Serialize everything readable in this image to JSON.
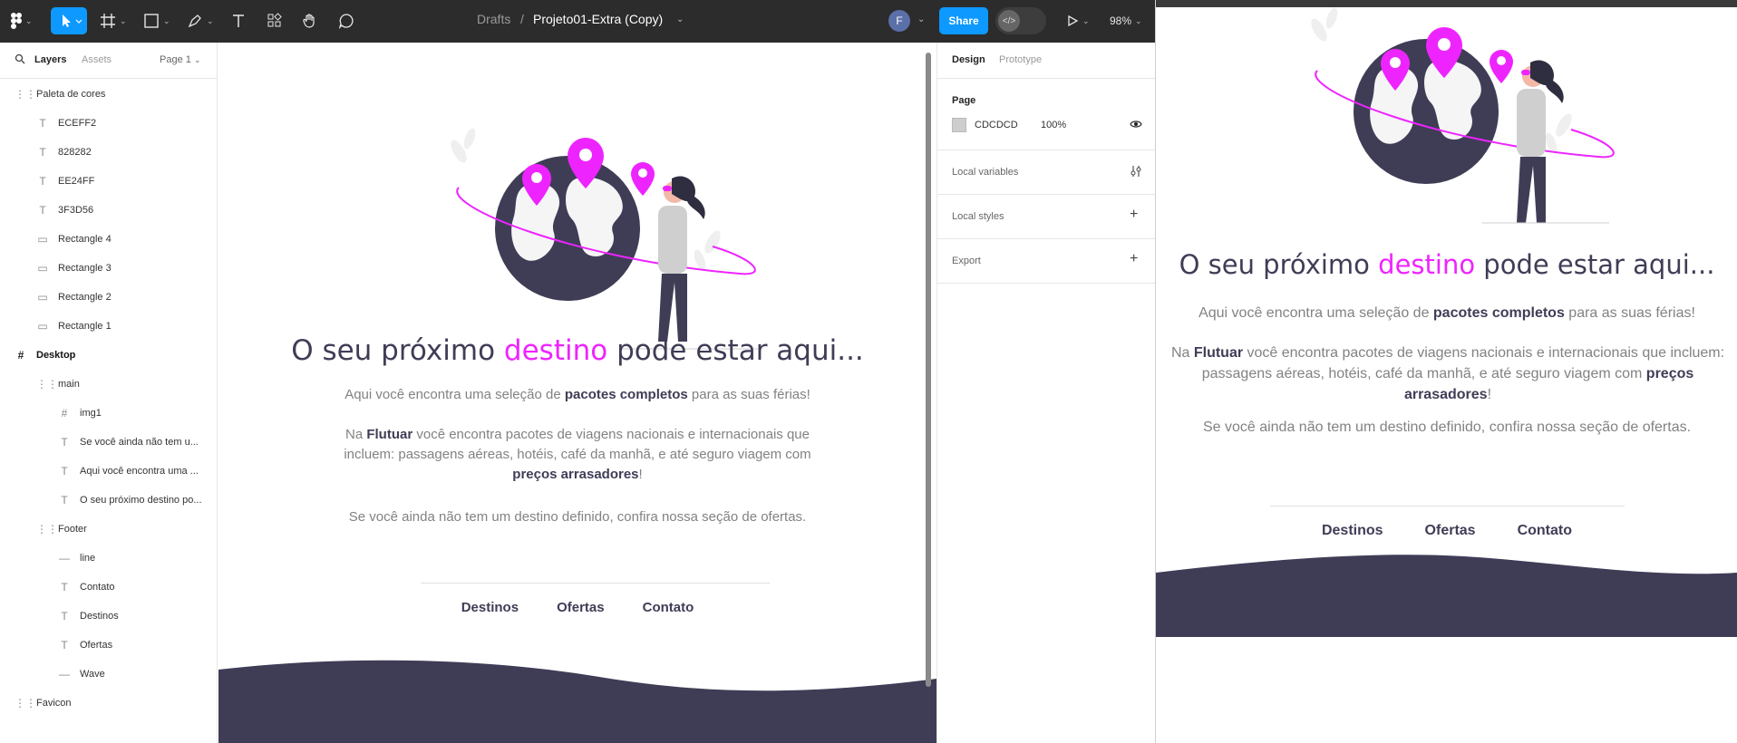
{
  "toolbar": {
    "breadcrumb_root": "Drafts",
    "breadcrumb_sep": "/",
    "file_name": "Projeto01-Extra (Copy)",
    "avatar_initial": "F",
    "share_label": "Share",
    "zoom": "98%"
  },
  "left_panel": {
    "tab_layers": "Layers",
    "tab_assets": "Assets",
    "page_selector": "Page 1",
    "layers": [
      {
        "label": "Paleta de cores",
        "icon": "section-icon",
        "depth": 0
      },
      {
        "label": "ECEFF2",
        "icon": "text-icon",
        "depth": 1
      },
      {
        "label": "828282",
        "icon": "text-icon",
        "depth": 1
      },
      {
        "label": "EE24FF",
        "icon": "text-icon",
        "depth": 1
      },
      {
        "label": "3F3D56",
        "icon": "text-icon",
        "depth": 1
      },
      {
        "label": "Rectangle 4",
        "icon": "rectangle-icon",
        "depth": 1
      },
      {
        "label": "Rectangle 3",
        "icon": "rectangle-icon",
        "depth": 1
      },
      {
        "label": "Rectangle 2",
        "icon": "rectangle-icon",
        "depth": 1
      },
      {
        "label": "Rectangle 1",
        "icon": "rectangle-icon",
        "depth": 1
      },
      {
        "label": "Desktop",
        "icon": "frame-icon",
        "depth": 0
      },
      {
        "label": "main",
        "icon": "group-icon",
        "depth": 1
      },
      {
        "label": "img1",
        "icon": "frame-icon",
        "depth": 2
      },
      {
        "label": "Se você ainda não tem u...",
        "icon": "text-icon",
        "depth": 2
      },
      {
        "label": "Aqui você encontra uma ...",
        "icon": "text-icon",
        "depth": 2
      },
      {
        "label": "O seu próximo destino po...",
        "icon": "text-icon",
        "depth": 2
      },
      {
        "label": "Footer",
        "icon": "group-icon",
        "depth": 1
      },
      {
        "label": "line",
        "icon": "line-icon",
        "depth": 2
      },
      {
        "label": "Contato",
        "icon": "text-icon",
        "depth": 2
      },
      {
        "label": "Destinos",
        "icon": "text-icon",
        "depth": 2
      },
      {
        "label": "Ofertas",
        "icon": "text-icon",
        "depth": 2
      },
      {
        "label": "Wave",
        "icon": "line-icon",
        "depth": 2
      },
      {
        "label": "Favicon",
        "icon": "section-icon",
        "depth": 0
      }
    ]
  },
  "right_panel": {
    "tab_design": "Design",
    "tab_prototype": "Prototype",
    "page_label": "Page",
    "page_color": "CDCDCD",
    "page_opacity": "100%",
    "local_variables": "Local variables",
    "local_styles": "Local styles",
    "export": "Export"
  },
  "site": {
    "heading_pre": "O seu próximo ",
    "heading_highlight": "destino",
    "heading_post": " pode estar aqui...",
    "p1_pre": "Aqui você encontra uma seleção de ",
    "p1_bold": "pacotes completos",
    "p1_post": " para as suas férias!",
    "p2_pre": "Na ",
    "p2_bold1": "Flutuar",
    "p2_mid": " você encontra pacotes de viagens nacionais e internacionais que incluem: passagens aéreas, hotéis, café da manhã, e até seguro viagem com ",
    "p2_bold2": "preços arrasadores",
    "p2_end": "!",
    "p3": "Se você ainda não tem um destino definido, confira nossa seção de ofertas.",
    "nav": [
      "Destinos",
      "Ofertas",
      "Contato"
    ]
  },
  "colors": {
    "accent": "#ee24ff",
    "dark": "#3f3d56",
    "gray": "#828282",
    "light": "#eceff2",
    "figma_blue": "#0d99ff"
  }
}
